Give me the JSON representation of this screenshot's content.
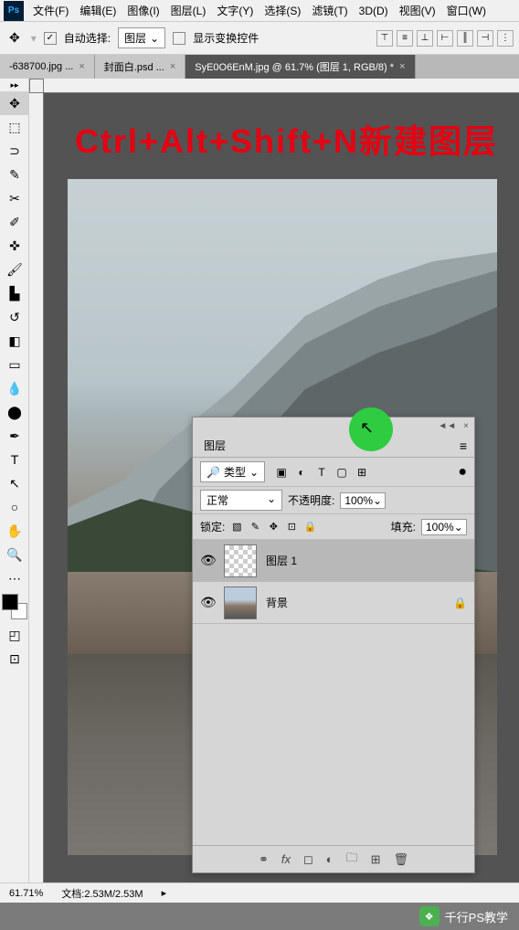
{
  "menu": {
    "items": [
      "文件(F)",
      "编辑(E)",
      "图像(I)",
      "图层(L)",
      "文字(Y)",
      "选择(S)",
      "滤镜(T)",
      "3D(D)",
      "视图(V)",
      "窗口(W)"
    ]
  },
  "options": {
    "auto_select_label": "自动选择:",
    "auto_select_checked": "✓",
    "target": "图层",
    "show_transform_label": "显示变换控件"
  },
  "tabs": {
    "items": [
      {
        "label": "-638700.jpg ...",
        "active": false
      },
      {
        "label": "封面白.psd ...",
        "active": false
      },
      {
        "label": "SyE0O6EnM.jpg @ 61.7% (图层 1, RGB/8) *",
        "active": true
      }
    ]
  },
  "tutorial": "Ctrl+Alt+Shift+N新建图层",
  "layers_panel": {
    "tab": "图层",
    "filter_label": "类型",
    "blend_mode": "正常",
    "opacity_label": "不透明度:",
    "opacity_value": "100%",
    "lock_label": "锁定:",
    "fill_label": "填充:",
    "fill_value": "100%",
    "layers": [
      {
        "name": "图层 1",
        "selected": true,
        "locked": false,
        "checker": true
      },
      {
        "name": "背景",
        "selected": false,
        "locked": true,
        "checker": false
      }
    ]
  },
  "status": {
    "zoom": "61.71%",
    "doc": "文档:2.53M/2.53M"
  },
  "watermark": "千行PS教学"
}
